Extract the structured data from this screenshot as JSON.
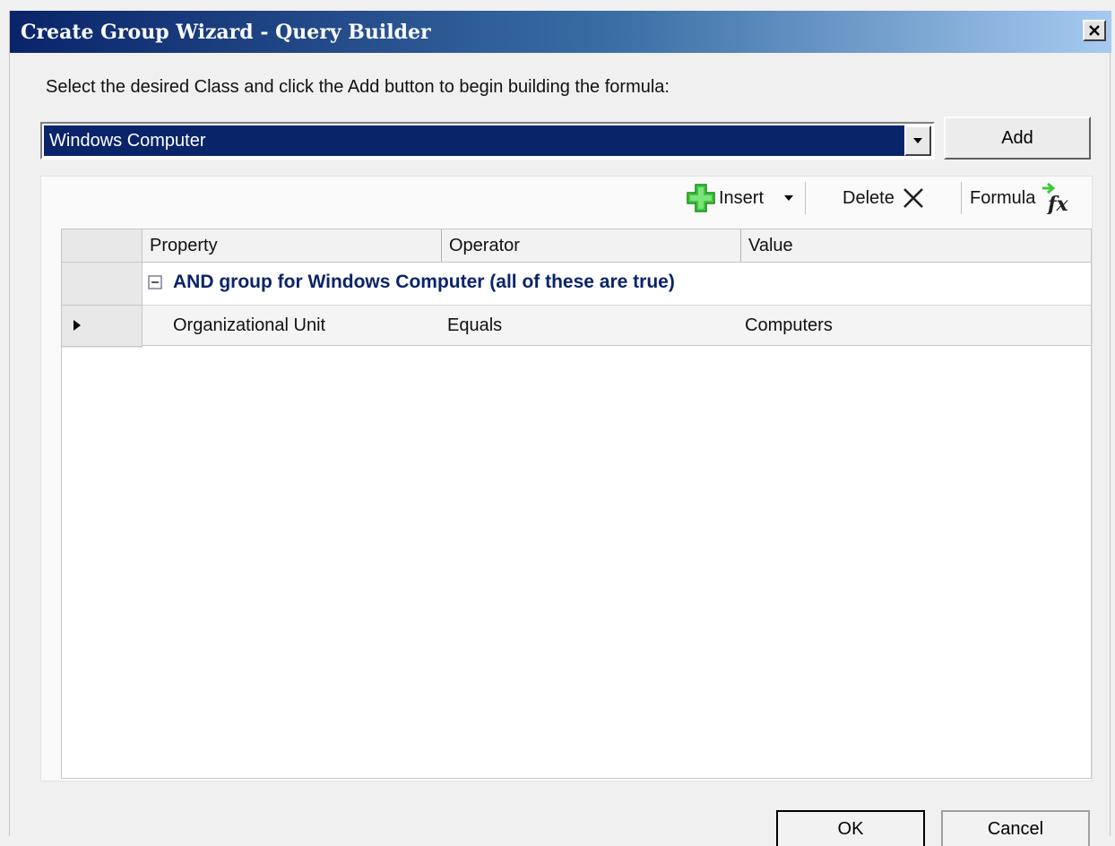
{
  "window": {
    "title": "Create Group Wizard - Query Builder",
    "close_label": "×"
  },
  "instruction": "Select the desired Class and click the Add button to begin building the formula:",
  "class_select": {
    "value": "Windows Computer"
  },
  "add_button": "Add",
  "toolbar": {
    "insert_label": "Insert",
    "delete_label": "Delete",
    "formula_label": "Formula"
  },
  "grid": {
    "columns": [
      "Property",
      "Operator",
      "Value"
    ],
    "group_label": "AND group for Windows Computer (all of these are true)",
    "rows": [
      {
        "property": "Organizational Unit",
        "operator": "Equals",
        "value": "Computers"
      }
    ]
  },
  "footer": {
    "ok_label": "OK",
    "cancel_label": "Cancel"
  },
  "colors": {
    "titlebar_start": "#0a246a",
    "titlebar_end": "#a6caf0",
    "selection": "#0a246a",
    "group_text": "#0a246a",
    "insert_icon": "#2fbf2f"
  },
  "icons": {
    "close": "close-icon",
    "dropdown": "chevron-down-icon",
    "insert": "plus-icon",
    "delete": "x-icon",
    "formula": "formula-icon",
    "collapse": "minus-box-icon",
    "row_pointer": "triangle-right-icon"
  }
}
